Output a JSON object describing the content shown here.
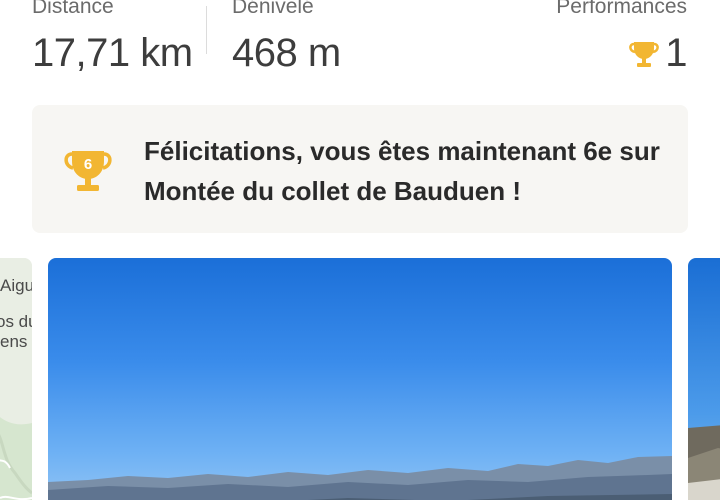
{
  "stats": {
    "distance": {
      "label": "Distance",
      "value": "17,71 km"
    },
    "elevation": {
      "label": "Dénivelé",
      "value": "468 m"
    },
    "performances": {
      "label": "Performances",
      "value": "1",
      "icon": "trophy-icon"
    }
  },
  "achievement": {
    "rank": "6",
    "icon": "trophy-rank-icon",
    "message": "Félicitations, vous êtes maintenant 6e sur Montée du collet de Bauduen !"
  },
  "map_labels": [
    "Aigu",
    "os du",
    "ens"
  ],
  "colors": {
    "trophy_gold": "#f2b632",
    "trophy_gold_dark": "#d99a1c",
    "card_background": "#f7f6f3",
    "text_primary": "#2a2a2a",
    "text_secondary": "#6b6b6b"
  }
}
